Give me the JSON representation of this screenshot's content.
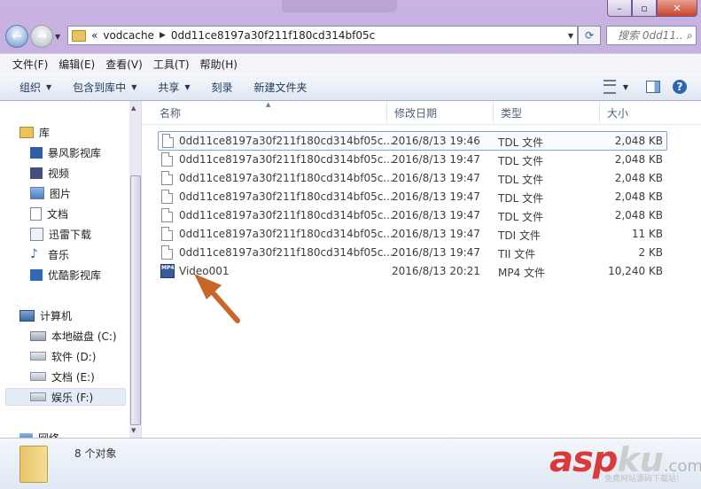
{
  "address": {
    "overflow": "«",
    "crumbs": [
      "vodcache",
      "0dd11ce8197a30f211f180cd314bf05c"
    ]
  },
  "search": {
    "placeholder": "搜索 0dd11..."
  },
  "menu": [
    "文件(F)",
    "编辑(E)",
    "查看(V)",
    "工具(T)",
    "帮助(H)"
  ],
  "toolbar": {
    "organize": "组织",
    "include_library": "包含到库中",
    "share": "共享",
    "burn": "刻录",
    "new_folder": "新建文件夹"
  },
  "tree": {
    "library": "库",
    "items": [
      "暴风影视库",
      "视频",
      "图片",
      "文档",
      "迅雷下载",
      "音乐",
      "优酷影视库"
    ],
    "computer": "计算机",
    "drives": [
      "本地磁盘 (C:)",
      "软件 (D:)",
      "文档 (E:)",
      "娱乐 (F:)"
    ],
    "network": "网络"
  },
  "columns": {
    "name": "名称",
    "date": "修改日期",
    "type": "类型",
    "size": "大小"
  },
  "files": [
    {
      "name": "0dd11ce8197a30f211f180cd314bf05c...",
      "date": "2016/8/13 19:46",
      "type": "TDL 文件",
      "size": "2,048 KB"
    },
    {
      "name": "0dd11ce8197a30f211f180cd314bf05c...",
      "date": "2016/8/13 19:47",
      "type": "TDL 文件",
      "size": "2,048 KB"
    },
    {
      "name": "0dd11ce8197a30f211f180cd314bf05c...",
      "date": "2016/8/13 19:47",
      "type": "TDL 文件",
      "size": "2,048 KB"
    },
    {
      "name": "0dd11ce8197a30f211f180cd314bf05c...",
      "date": "2016/8/13 19:47",
      "type": "TDL 文件",
      "size": "2,048 KB"
    },
    {
      "name": "0dd11ce8197a30f211f180cd314bf05c...",
      "date": "2016/8/13 19:47",
      "type": "TDL 文件",
      "size": "2,048 KB"
    },
    {
      "name": "0dd11ce8197a30f211f180cd314bf05c...",
      "date": "2016/8/13 19:47",
      "type": "TDI 文件",
      "size": "11 KB"
    },
    {
      "name": "0dd11ce8197a30f211f180cd314bf05c...",
      "date": "2016/8/13 19:47",
      "type": "TII 文件",
      "size": "2 KB"
    },
    {
      "name": "Video001",
      "date": "2016/8/13 20:21",
      "type": "MP4 文件",
      "size": "10,240 KB"
    }
  ],
  "status": {
    "count": "8 个对象"
  },
  "watermark": {
    "asp": "asp",
    "ku": "ku",
    "com": ".com",
    "sub": "免费网站源码下载站!"
  },
  "colors": {
    "accent": "#2b66b0",
    "arrow": "#c8662a",
    "watermark_red": "#d93a3a"
  }
}
